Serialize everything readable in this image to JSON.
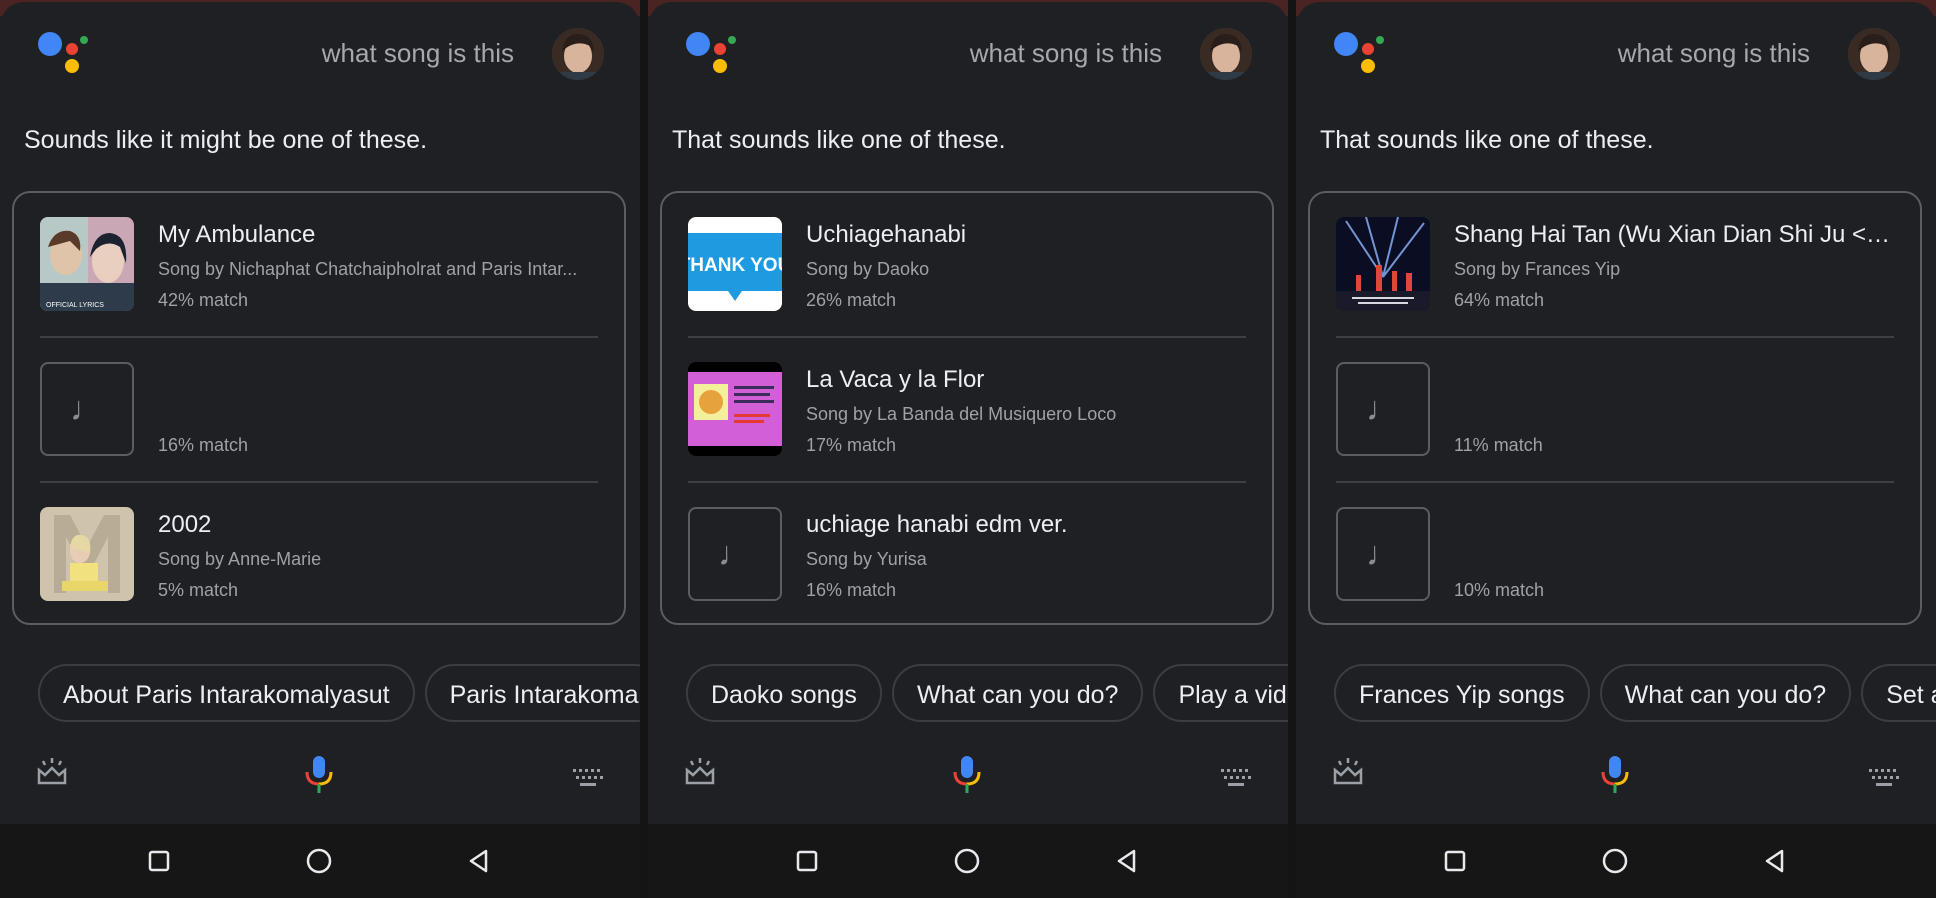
{
  "query": "what song is this",
  "panels": [
    {
      "response": "Sounds like it might be one of these.",
      "songs": [
        {
          "title": "My Ambulance",
          "artist": "Song by Nichaphat Chatchaipholrat and Paris Intar...",
          "match": "42% match",
          "art": "my-ambulance-art",
          "art_text": "OFFICIAL LYRICS"
        },
        {
          "title": "",
          "artist": "",
          "match": "16% match",
          "art": "music-note"
        },
        {
          "title": "2002",
          "artist": "Song by Anne-Marie",
          "match": "5% match",
          "art": "anne-marie-art"
        }
      ],
      "chips": [
        "About Paris Intarakomalyasut",
        "Paris Intarakoma"
      ]
    },
    {
      "response": "That sounds like one of these.",
      "songs": [
        {
          "title": "Uchiagehanabi",
          "artist": "Song by Daoko",
          "match": "26% match",
          "art": "thank-you-art",
          "art_text": "THANK YOU"
        },
        {
          "title": "La Vaca y la Flor",
          "artist": "Song by La Banda del Musiquero Loco",
          "match": "17% match",
          "art": "la-vaca-art"
        },
        {
          "title": "uchiage hanabi edm ver.",
          "artist": "Song by Yurisa",
          "match": "16% match",
          "art": "music-note"
        }
      ],
      "chips": [
        "Daoko songs",
        "What can you do?",
        "Play a vide"
      ]
    },
    {
      "response": "That sounds like one of these.",
      "songs": [
        {
          "title": "Shang Hai Tan (Wu Xian Dian Shi Ju <<...",
          "artist": "Song by Frances Yip",
          "match": "64% match",
          "art": "shanghai-art"
        },
        {
          "title": "",
          "artist": "",
          "match": "11% match",
          "art": "music-note"
        },
        {
          "title": "",
          "artist": "",
          "match": "10% match",
          "art": "music-note"
        }
      ],
      "chips": [
        "Frances Yip songs",
        "What can you do?",
        "Set a"
      ]
    }
  ],
  "colors": {
    "background": "#1f2023",
    "google_blue": "#4285f4",
    "google_red": "#ea4335",
    "google_yellow": "#fbbc05",
    "google_green": "#34a853"
  },
  "icons": {
    "assistant": "google-assistant-logo-icon",
    "snapshot": "snapshot-icon",
    "mic": "mic-icon",
    "keyboard": "keyboard-icon",
    "nav": [
      "recents-square-icon",
      "home-circle-icon",
      "back-triangle-icon"
    ]
  }
}
